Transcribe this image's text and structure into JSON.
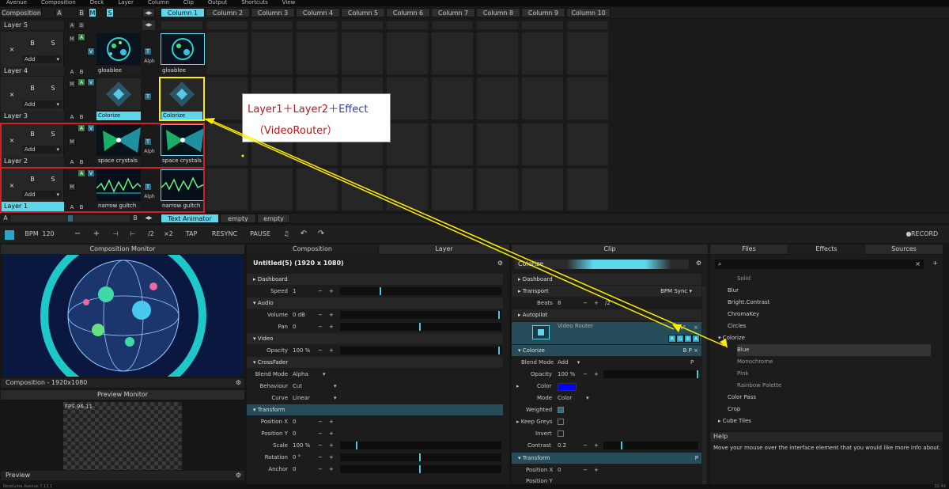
{
  "menu": [
    "Avenue",
    "Composition",
    "Deck",
    "Layer",
    "Column",
    "Clip",
    "Output",
    "Shortcuts",
    "View"
  ],
  "columns": [
    "Column 1",
    "Column 2",
    "Column 3",
    "Column 4",
    "Column 5",
    "Column 6",
    "Column 7",
    "Column 8",
    "Column 9",
    "Column 10"
  ],
  "composition_label": "Composition",
  "layers": [
    {
      "name": "Layer 5",
      "clips": []
    },
    {
      "name": "Layer 4",
      "clip_names": [
        "gloablee",
        "gloablee"
      ]
    },
    {
      "name": "Layer 3",
      "clip_names": [
        "Colorize",
        "Colorize"
      ]
    },
    {
      "name": "Layer 2",
      "clip_names": [
        "space crystals",
        "space crystals"
      ]
    },
    {
      "name": "Layer 1",
      "clip_names": [
        "narrow gultch",
        "narrow gultch"
      ]
    }
  ],
  "layer_controls": {
    "close": "×",
    "b": "B",
    "s": "S",
    "add": "Add",
    "a": "A",
    "m": "M",
    "v": "V",
    "t": "T",
    "alph": "Alph"
  },
  "deck_tabs": [
    "Text Animator",
    "empty",
    "empty"
  ],
  "bottom_left": {
    "a": "A",
    "b": "B"
  },
  "transport": {
    "bpm_label": "BPM",
    "bpm": "120",
    "buttons": [
      "−",
      "+",
      "⊣",
      "⊢",
      "/2",
      "×2",
      "TAP",
      "RESYNC",
      "PAUSE"
    ],
    "record": "RECORD"
  },
  "panels": {
    "composition_monitor": "Composition Monitor",
    "composition_info": "Composition - 1920x1080",
    "preview_monitor": "Preview Monitor",
    "fps": "FPS 96.11",
    "preview": "Preview",
    "composition_tab": "Composition",
    "layer_tab": "Layer",
    "clip_tab": "Clip",
    "files_tab": "Files",
    "effects_tab": "Effects",
    "sources_tab": "Sources",
    "comp_title": "Untitled(5) (1920 x 1080)",
    "clip_name": "Colorize"
  },
  "composition_props": [
    {
      "type": "section",
      "label": "Dashboard"
    },
    {
      "type": "prop",
      "label": "Speed",
      "value": "1"
    },
    {
      "type": "section",
      "label": "Audio"
    },
    {
      "type": "prop",
      "label": "Volume",
      "value": "0 dB"
    },
    {
      "type": "prop",
      "label": "Pan",
      "value": "0"
    },
    {
      "type": "section",
      "label": "Video"
    },
    {
      "type": "prop",
      "label": "Opacity",
      "value": "100 %"
    },
    {
      "type": "section",
      "label": "CrossFader"
    },
    {
      "type": "prop",
      "label": "Blend Mode",
      "value": "Alpha"
    },
    {
      "type": "prop",
      "label": "Behaviour",
      "value": "Cut"
    },
    {
      "type": "prop",
      "label": "Curve",
      "value": "Linear"
    },
    {
      "type": "section",
      "label": "Transform"
    },
    {
      "type": "prop",
      "label": "Position X",
      "value": "0"
    },
    {
      "type": "prop",
      "label": "Position Y",
      "value": "0"
    },
    {
      "type": "prop",
      "label": "Scale",
      "value": "100 %"
    },
    {
      "type": "prop",
      "label": "Rotation",
      "value": "0 °"
    },
    {
      "type": "prop",
      "label": "Anchor",
      "value": "0"
    }
  ],
  "clip_props": {
    "dashboard": "Dashboard",
    "transport": "Transport",
    "bpm_sync": "BPM Sync",
    "beats_label": "Beats",
    "beats": "8",
    "div": "/2",
    "autopilot": "Autopilot",
    "video_router": "Video Router",
    "rgba": [
      "R",
      "G",
      "B",
      "A"
    ],
    "colorize": "Colorize",
    "blend_mode_label": "Blend Mode",
    "blend_mode": "Add",
    "opacity_label": "Opacity",
    "opacity": "100 %",
    "color_label": "Color",
    "mode_label": "Mode",
    "mode": "Color",
    "weighted_label": "Weighted",
    "keep_greys_label": "Keep Greys",
    "invert_label": "Invert",
    "contrast_label": "Contrast",
    "contrast": "0.2",
    "transform": "Transform",
    "position_x_label": "Position X",
    "position_x": "0",
    "position_y_label": "Position Y",
    "color_value": "#0000ff"
  },
  "effects_list": [
    "Solid",
    "Blur",
    "Bright.Contrast",
    "ChromaKey",
    "Circles",
    "Colorize",
    "Blue",
    "Monochrome",
    "Pink",
    "Rainbow Palette",
    "Color Pass",
    "Crop",
    "Cube Tiles"
  ],
  "help": {
    "title": "Help",
    "text": "Move your mouse over the interface element that you would like more info about."
  },
  "status": {
    "left": "Resolume Avenue 7.13.1",
    "right": "02:49"
  },
  "annotation": {
    "part1": "Layer1",
    "plus1": "＋",
    "part2": "Layer2",
    "plus2": "＋",
    "part3": "Effect",
    "line2": "（VideoRouter）"
  },
  "colors": {
    "accent": "#5fd6ea",
    "annotation_red": "#b0191d",
    "annotation_blue": "#2f3f8f",
    "highlight_yellow": "#ffee00",
    "frame_red": "#d0202a"
  }
}
